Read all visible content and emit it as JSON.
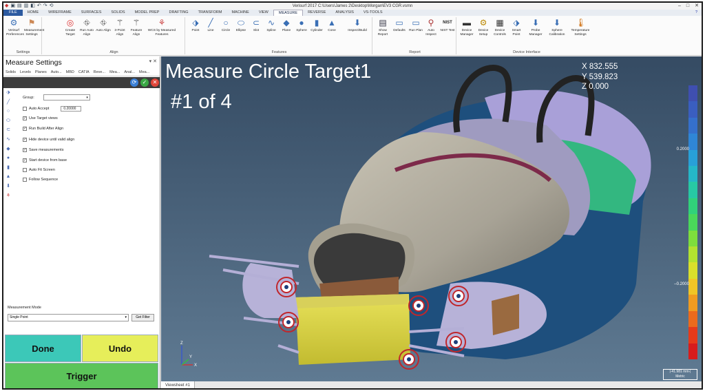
{
  "titlebar": {
    "title": "Verisurf 2017 C:\\Users\\James 2\\Desktop\\Morgan\\EV3 CGR.vsmn",
    "qa_icons": [
      "▣",
      "▤",
      "▥",
      "◧",
      "↶",
      "↷",
      "⟲"
    ],
    "help": "?",
    "win_min": "–",
    "win_max": "□",
    "win_close": "✕"
  },
  "tabs": [
    "FILE",
    "HOME",
    "WIREFRAME",
    "SURFACES",
    "SOLIDS",
    "MODEL PREP",
    "DRAFTING",
    "TRANSFORM",
    "MACHINE",
    "VIEW",
    "MEASURE",
    "REVERSE",
    "ANALYSIS",
    "VS-TOOLS"
  ],
  "active_tab": "MEASURE",
  "ribbon": {
    "settings": {
      "label": "Settings",
      "buttons": [
        "Verisurf Preferences",
        "Measurement Settings"
      ]
    },
    "align": {
      "label": "Align",
      "buttons": [
        "Create Target",
        "Run Auto Align",
        "Auto Align",
        "3-Point Align",
        "Feature Align",
        "WCS by Measured Features"
      ]
    },
    "features": {
      "label": "Features",
      "buttons": [
        "Point",
        "Line",
        "Circle",
        "Ellipse",
        "Slot",
        "Spline",
        "Plane",
        "Sphere",
        "Cylinder",
        "Cone",
        "Inspect/Build"
      ]
    },
    "report": {
      "label": "Report",
      "buttons": [
        "Show Report",
        "Defaults",
        "Run Plan",
        "Auto Inspect",
        "NIST Test"
      ]
    },
    "device": {
      "label": "Device Interface",
      "buttons": [
        "Device Manager",
        "Device Setup",
        "Device Controls",
        "Smart Point",
        "Probe Manager",
        "Sphere Calibration",
        "Temperature Settings"
      ]
    }
  },
  "panel": {
    "title": "Measure Settings",
    "pin": "▾ ✕",
    "tabs": [
      "Solids",
      "Levels",
      "Planes",
      "Auto...",
      "MBD",
      "CATIA",
      "Reve...",
      "Mea...",
      "Anal...",
      "Mea..."
    ],
    "group_label": "Group:",
    "group_value": "",
    "auto_accept": "Auto Accept",
    "auto_accept_value": "0.20000",
    "checks": [
      {
        "label": "Use Target views",
        "checked": true
      },
      {
        "label": "Run Build After Align",
        "checked": true
      },
      {
        "label": "Hide device until valid align",
        "checked": true
      },
      {
        "label": "Save measurements",
        "checked": true
      },
      {
        "label": "Start device from base",
        "checked": true
      },
      {
        "label": "Auto Fit Screen",
        "checked": false
      },
      {
        "label": "Follow Sequence",
        "checked": false
      }
    ],
    "measurement_mode_label": "Measurement Mode",
    "measurement_mode_value": "Single Point",
    "get_filter": "Get Filter",
    "done": "Done",
    "undo": "Undo",
    "trigger": "Trigger"
  },
  "viewport": {
    "title": "Measure Circle Target1",
    "subtitle": "#1 of 4",
    "coords": {
      "x": "X  832.555",
      "y": "Y  539.823",
      "z": "Z    0.000"
    },
    "scale_top": "0.2000",
    "scale_bottom": "–0.2000",
    "scale_box": "|-41.981 mm-|",
    "scale_unit": "Metric",
    "axis_label": "Z",
    "scale_colors": [
      "#3f4fb0",
      "#3a5ec0",
      "#3570cc",
      "#2f86d6",
      "#28a0d8",
      "#25b7c8",
      "#27c9a4",
      "#31d27a",
      "#4ad85a",
      "#7ede3c",
      "#b2e230",
      "#d9df2b",
      "#f0c526",
      "#f09b20",
      "#ec6a1c",
      "#e63a1a",
      "#d81c1c"
    ],
    "gadget_labels": [
      "Z",
      "Y",
      "X"
    ]
  },
  "viewsheet_tab": "Viewsheet #1"
}
